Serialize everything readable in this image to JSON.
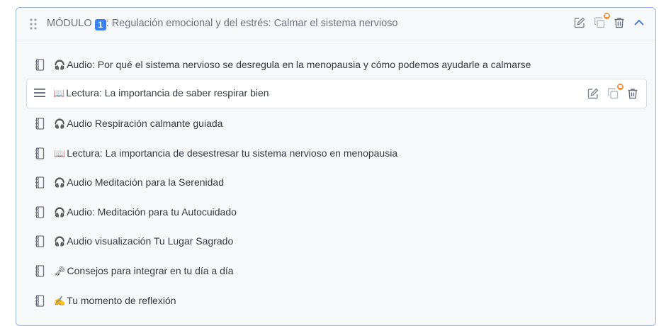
{
  "module": {
    "prefix": "MÓDULO",
    "number": "1",
    "title_rest": ": Regulación emocional y del estrés: Calmar el sistema nervioso",
    "actions": [
      "edit-icon",
      "duplicate-icon",
      "trash-icon",
      "chevron-up-icon"
    ]
  },
  "lessons": [
    {
      "emoji": "🎧",
      "text": "Audio: Por qué el sistema nervioso se desregula en la menopausia y cómo podemos ayudarle a calmarse"
    },
    {
      "emoji": "📖",
      "text": "Lectura: La importancia de saber respirar bien",
      "selected": true
    },
    {
      "emoji": "🎧",
      "text": "Audio Respiración calmante guiada"
    },
    {
      "emoji": "📖",
      "text": "Lectura: La importancia de desestresar tu sistema nervioso en menopausia"
    },
    {
      "emoji": "🎧",
      "text": "Audio Meditación para la Serenidad"
    },
    {
      "emoji": "🎧",
      "text": "Audio: Meditación para tu Autocuidado"
    },
    {
      "emoji": "🎧",
      "text": "Audio visualización Tu Lugar Sagrado"
    },
    {
      "emoji": "🗝",
      "text": "Consejos para integrar en tu día a día"
    },
    {
      "emoji": "✍️",
      "text": "Tu momento de reflexión"
    }
  ],
  "colors": {
    "accent": "#3b82f6",
    "border": "#9fb7e4",
    "badge": "#f28a3c"
  }
}
